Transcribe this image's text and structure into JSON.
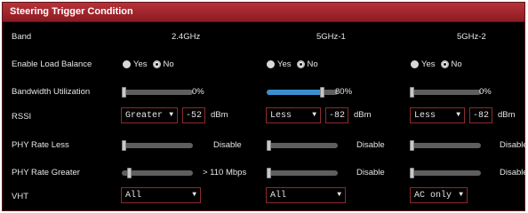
{
  "title": "Steering Trigger Condition",
  "band_header": {
    "label": "Band",
    "cols": [
      "2.4GHz",
      "5GHz-1",
      "5GHz-2"
    ]
  },
  "rows": {
    "load_balance": {
      "label": "Enable Load Balance",
      "yes": "Yes",
      "no": "No",
      "selected": [
        "No",
        "No",
        "No"
      ]
    },
    "bandwidth": {
      "label": "Bandwidth Utilization",
      "values": [
        "0%",
        "80%",
        "0%"
      ],
      "levels": [
        0,
        0.8,
        0
      ]
    },
    "rssi": {
      "label": "RSSI",
      "conditions": [
        "Greater",
        "Less",
        "Less"
      ],
      "values": [
        "-52",
        "-82",
        "-82"
      ],
      "unit": "dBm"
    },
    "phy_less": {
      "label": "PHY Rate Less",
      "values": [
        "Disable",
        "Disable",
        "Disable"
      ]
    },
    "phy_greater": {
      "label": "PHY Rate Greater",
      "values": [
        "> 110 Mbps",
        "Disable",
        "Disable"
      ]
    },
    "vht": {
      "label": "VHT",
      "values": [
        "All",
        "All",
        "AC only"
      ]
    }
  },
  "colors": {
    "title_bar": "#a0232b",
    "select_border": "#8e2a2f",
    "slider_fill": "#3a8fd0"
  }
}
